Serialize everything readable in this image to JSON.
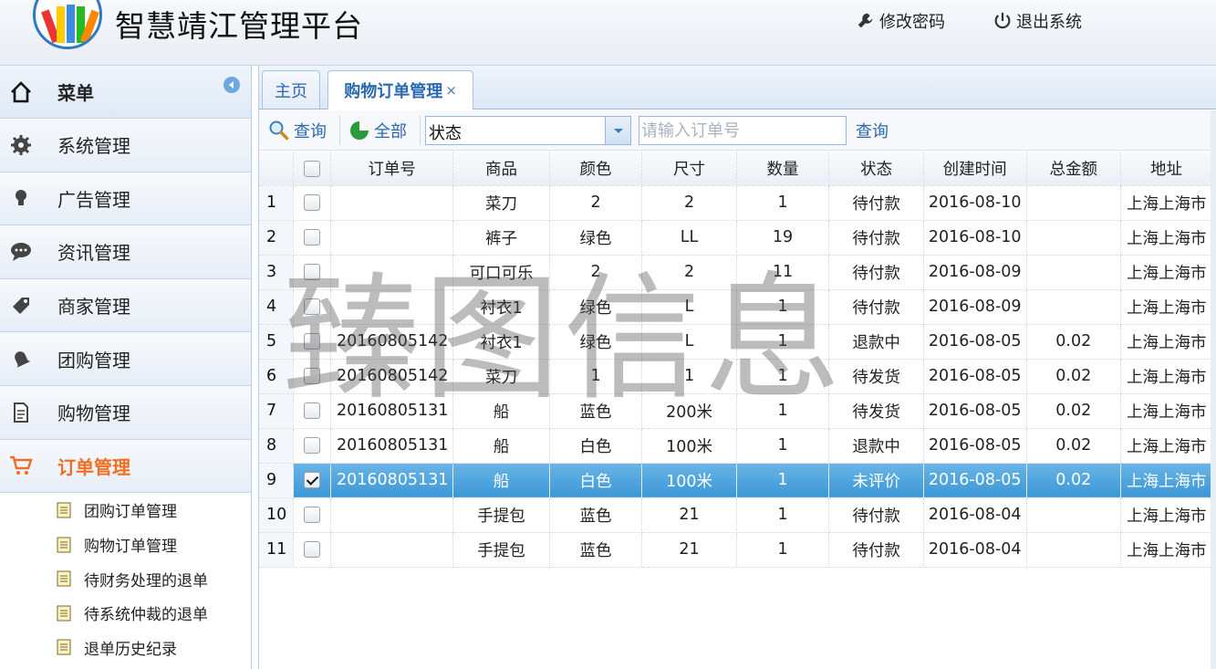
{
  "app": {
    "title": "智慧靖江管理平台"
  },
  "header": {
    "change_password": "修改密码",
    "logout": "退出系统"
  },
  "sidebar": {
    "title": "菜单",
    "items": [
      {
        "label": "系统管理",
        "icon": "gear-icon"
      },
      {
        "label": "广告管理",
        "icon": "lightbulb-icon"
      },
      {
        "label": "资讯管理",
        "icon": "chat-bubble-icon"
      },
      {
        "label": "商家管理",
        "icon": "tag-icon"
      },
      {
        "label": "团购管理",
        "icon": "bell-icon"
      },
      {
        "label": "购物管理",
        "icon": "document-icon"
      },
      {
        "label": "订单管理",
        "icon": "cart-icon",
        "active": true
      }
    ],
    "sub_items": [
      "团购订单管理",
      "购物订单管理",
      "待财务处理的退单",
      "待系统仲裁的退单",
      "退单历史纪录"
    ]
  },
  "tabs": [
    {
      "label": "主页"
    },
    {
      "label": "购物订单管理",
      "close": "×",
      "active": true
    }
  ],
  "toolbar": {
    "query_label": "查询",
    "all_label": "全部",
    "status_value": "状态",
    "order_placeholder": "请输入订单号",
    "search_label": "查询"
  },
  "table": {
    "headers": [
      "订单号",
      "商品",
      "颜色",
      "尺寸",
      "数量",
      "状态",
      "创建时间",
      "总金额",
      "地址"
    ],
    "rows": [
      {
        "n": "1",
        "checked": false,
        "order": "",
        "product": "菜刀",
        "color": "2",
        "size": "2",
        "qty": "1",
        "status": "待付款",
        "date": "2016-08-10",
        "total": "",
        "addr": "上海上海市"
      },
      {
        "n": "2",
        "checked": false,
        "order": "",
        "product": "裤子",
        "color": "绿色",
        "size": "LL",
        "qty": "19",
        "status": "待付款",
        "date": "2016-08-10",
        "total": "",
        "addr": "上海上海市"
      },
      {
        "n": "3",
        "checked": false,
        "order": "",
        "product": "可口可乐",
        "color": "2",
        "size": "2",
        "qty": "11",
        "status": "待付款",
        "date": "2016-08-09",
        "total": "",
        "addr": "上海上海市"
      },
      {
        "n": "4",
        "checked": false,
        "order": "",
        "product": "衬衣1",
        "color": "绿色",
        "size": "L",
        "qty": "1",
        "status": "待付款",
        "date": "2016-08-09",
        "total": "",
        "addr": "上海上海市"
      },
      {
        "n": "5",
        "checked": false,
        "order": "20160805142",
        "product": "衬衣1",
        "color": "绿色",
        "size": "L",
        "qty": "1",
        "status": "退款中",
        "date": "2016-08-05",
        "total": "0.02",
        "addr": "上海上海市"
      },
      {
        "n": "6",
        "checked": false,
        "order": "20160805142",
        "product": "菜刀",
        "color": "1",
        "size": "1",
        "qty": "1",
        "status": "待发货",
        "date": "2016-08-05",
        "total": "0.02",
        "addr": "上海上海市"
      },
      {
        "n": "7",
        "checked": false,
        "order": "20160805131",
        "product": "船",
        "color": "蓝色",
        "size": "200米",
        "qty": "1",
        "status": "待发货",
        "date": "2016-08-05",
        "total": "0.02",
        "addr": "上海上海市"
      },
      {
        "n": "8",
        "checked": false,
        "order": "20160805131",
        "product": "船",
        "color": "白色",
        "size": "100米",
        "qty": "1",
        "status": "退款中",
        "date": "2016-08-05",
        "total": "0.02",
        "addr": "上海上海市"
      },
      {
        "n": "9",
        "checked": true,
        "order": "20160805131",
        "product": "船",
        "color": "白色",
        "size": "100米",
        "qty": "1",
        "status": "未评价",
        "date": "2016-08-05",
        "total": "0.02",
        "addr": "上海上海市",
        "selected": true
      },
      {
        "n": "10",
        "checked": false,
        "order": "",
        "product": "手提包",
        "color": "蓝色",
        "size": "21",
        "qty": "1",
        "status": "待付款",
        "date": "2016-08-04",
        "total": "",
        "addr": "上海上海市"
      },
      {
        "n": "11",
        "checked": false,
        "order": "",
        "product": "手提包",
        "color": "蓝色",
        "size": "21",
        "qty": "1",
        "status": "待付款",
        "date": "2016-08-04",
        "total": "",
        "addr": "上海上海市"
      }
    ]
  },
  "watermark": "臻图信息",
  "colors": {
    "accent": "#2a68b0",
    "active_menu": "#f06e22",
    "selected_row": "#4aa3dd"
  }
}
